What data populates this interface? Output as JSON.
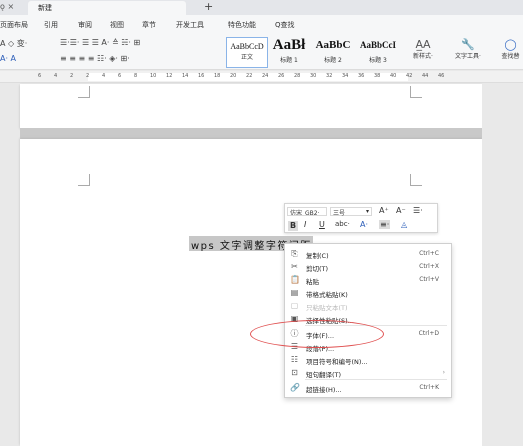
{
  "tabstrip": {
    "left_glyphs": "ǫ ×",
    "active_tab": "新建",
    "new_tab": "+"
  },
  "menu": {
    "items": [
      "页面布局",
      "引用",
      "审阅",
      "视图",
      "章节",
      "开发工具",
      "特色功能"
    ],
    "search": "Q查找"
  },
  "ribbon": {
    "row1_left": "A ◇ 变·",
    "row1_mid": "☰·☰· ☰ ☰ A·  ≙  ☵· ⊞",
    "row2_left": "A· A",
    "row2_mid": "≡ ≡ ≡ ≡ ☷· ◈· ⊞·",
    "styles": [
      {
        "sample": "AaBbCcD",
        "name": "正文"
      },
      {
        "sample": "AaBł",
        "name": "标题 1"
      },
      {
        "sample": "AaBbC",
        "name": "标题 2"
      },
      {
        "sample": "AaBbCcI",
        "name": "标题 3"
      }
    ],
    "new_style": "新样式·",
    "text_tool": "文字工具·",
    "find_replace": "查找替"
  },
  "ruler": {
    "numbers": [
      "6",
      "4",
      "2",
      "2",
      "4",
      "6",
      "8",
      "10",
      "12",
      "14",
      "16",
      "18",
      "20",
      "22",
      "24",
      "26",
      "28",
      "30",
      "32",
      "34",
      "36",
      "38",
      "40",
      "42",
      "44",
      "46"
    ]
  },
  "document": {
    "selected_text": "wps 文字调整字符间距"
  },
  "mini_toolbar": {
    "font": "仿宋_GB2·",
    "size": "三号",
    "grow": "A⁺",
    "shrink": "A⁻",
    "list": "☰·",
    "bold": "B",
    "italic": "I",
    "underline": "U",
    "strike": "abc·",
    "font_color": "A·",
    "align": "≡·",
    "clear": "◬"
  },
  "context_menu": [
    {
      "icon": "copy-icon",
      "glyph": "⎘",
      "label": "复制(C)",
      "shortcut": "Ctrl+C",
      "disabled": false
    },
    {
      "icon": "cut-icon",
      "glyph": "✂",
      "label": "剪切(T)",
      "shortcut": "Ctrl+X",
      "disabled": false
    },
    {
      "icon": "paste-icon",
      "glyph": "📋",
      "label": "粘贴",
      "shortcut": "Ctrl+V",
      "disabled": false
    },
    {
      "icon": "paste-format-icon",
      "glyph": "▤",
      "label": "带格式粘贴(K)",
      "shortcut": "",
      "disabled": false
    },
    {
      "icon": "paste-text-icon",
      "glyph": "▢",
      "label": "只粘贴文本(T)",
      "shortcut": "",
      "disabled": true
    },
    {
      "icon": "paste-special-icon",
      "glyph": "▣",
      "label": "选择性粘贴(S)...",
      "shortcut": "",
      "disabled": false
    },
    {
      "icon": "font-icon",
      "glyph": "ⓘ",
      "label": "字体(F)...",
      "shortcut": "Ctrl+D",
      "disabled": false
    },
    {
      "icon": "paragraph-icon",
      "glyph": "☰",
      "label": "段落(P)...",
      "shortcut": "",
      "disabled": false
    },
    {
      "icon": "bullets-icon",
      "glyph": "☷",
      "label": "项目符号和编号(N)...",
      "shortcut": "",
      "disabled": false
    },
    {
      "icon": "translate-icon",
      "glyph": "⊡",
      "label": "短句翻译(T)",
      "shortcut": "",
      "disabled": false,
      "submenu": "›"
    },
    {
      "icon": "hyperlink-icon",
      "glyph": "🔗",
      "label": "超链接(H)...",
      "shortcut": "Ctrl+K",
      "disabled": false
    }
  ],
  "colors": {
    "annotation_ellipse": "#e05050",
    "selection": "#c7c7c7",
    "normal_style_border": "#8ab4e8"
  }
}
